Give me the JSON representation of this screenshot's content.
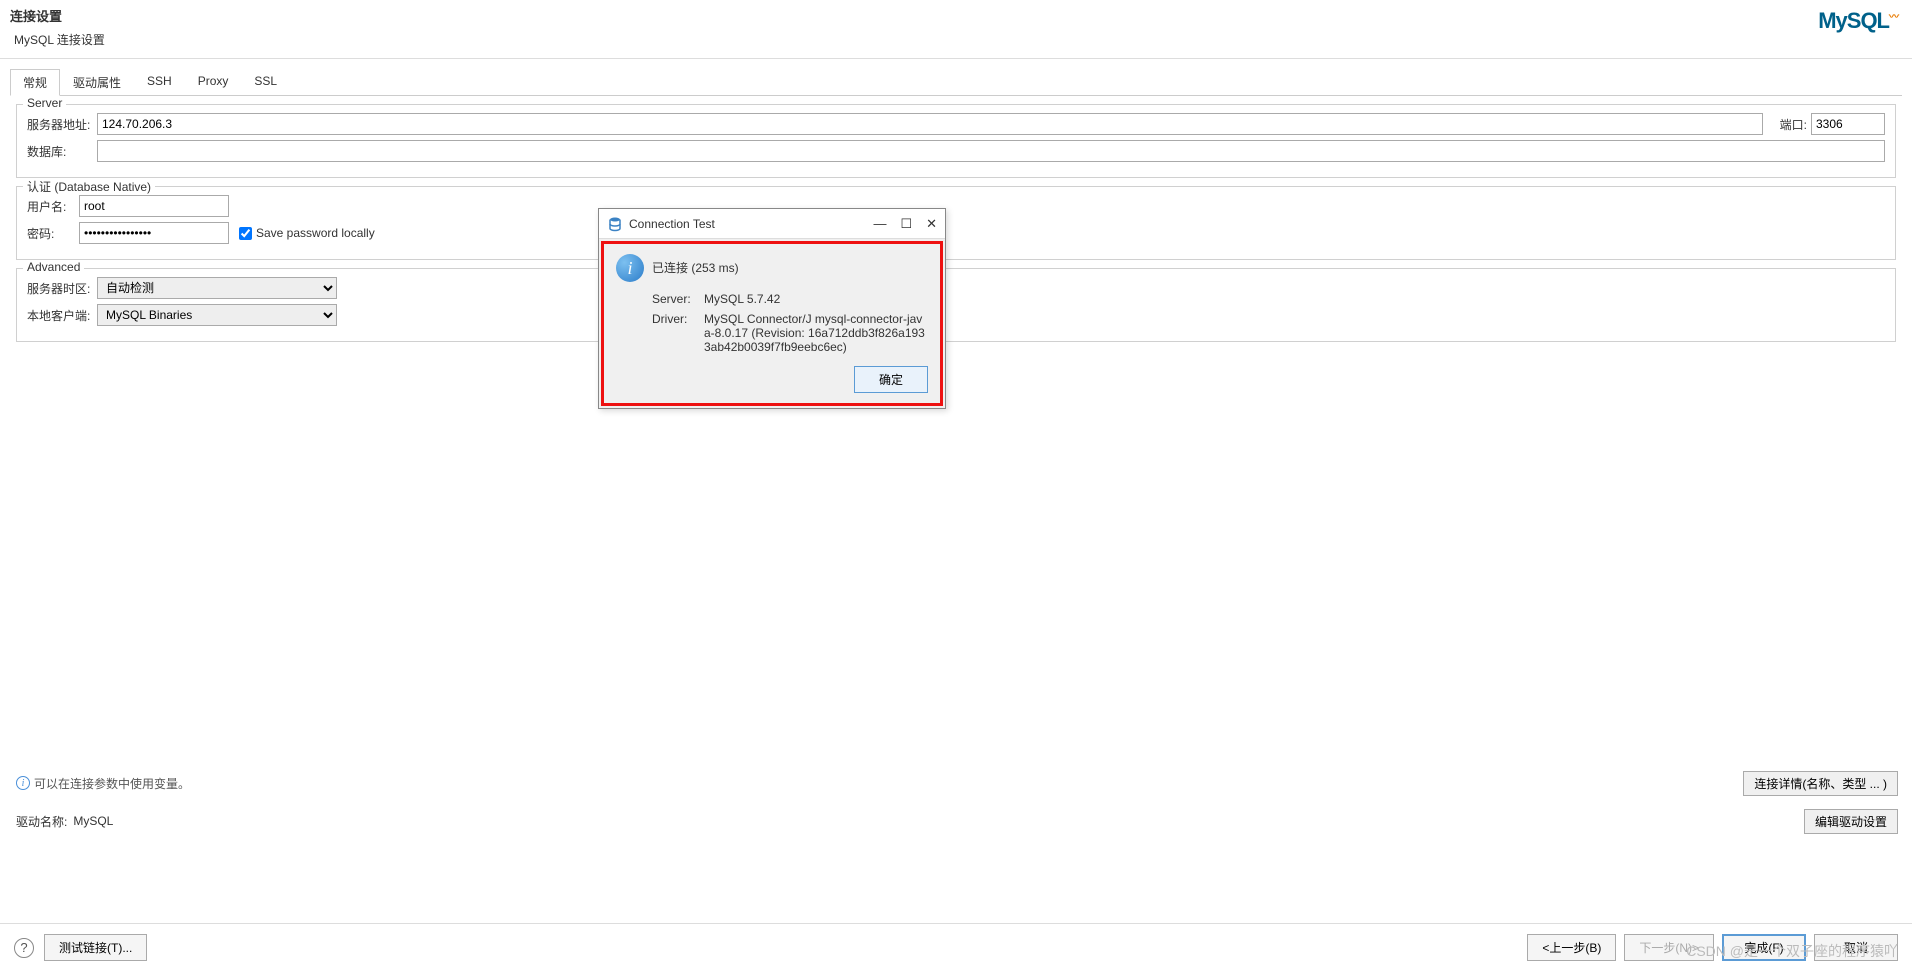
{
  "header": {
    "title": "连接设置",
    "subtitle": "MySQL 连接设置",
    "logo_text": "MySQL"
  },
  "tabs": {
    "items": [
      {
        "label": "常规"
      },
      {
        "label": "驱动属性"
      },
      {
        "label": "SSH"
      },
      {
        "label": "Proxy"
      },
      {
        "label": "SSL"
      }
    ]
  },
  "server_group": {
    "legend": "Server",
    "host_label": "服务器地址:",
    "host_value": "124.70.206.3",
    "port_label": "端口:",
    "port_value": "3306",
    "db_label": "数据库:",
    "db_value": ""
  },
  "auth_group": {
    "legend": "认证 (Database Native)",
    "user_label": "用户名:",
    "user_value": "root",
    "password_label": "密码:",
    "password_value": "••••••••••••••••",
    "save_password_label": "Save password locally",
    "save_password_checked": true
  },
  "advanced_group": {
    "legend": "Advanced",
    "timezone_label": "服务器时区:",
    "timezone_value": "自动检测",
    "client_label": "本地客户端:",
    "client_value": "MySQL Binaries"
  },
  "info": {
    "hint": "可以在连接参数中使用变量。",
    "conn_details_btn": "连接详情(名称、类型 ... )",
    "driver_name_label": "驱动名称:",
    "driver_name_value": "MySQL",
    "edit_driver_btn": "编辑驱动设置"
  },
  "footer": {
    "test_btn": "测试链接(T)...",
    "back_btn": "<上一步(B)",
    "next_btn": "下一步(N)>",
    "finish_btn": "完成(F)",
    "cancel_btn": "取消"
  },
  "dialog": {
    "title": "Connection Test",
    "connected_text": "已连接 (253 ms)",
    "server_label": "Server:",
    "server_value": "MySQL 5.7.42",
    "driver_label": "Driver:",
    "driver_value": "MySQL Connector/J mysql-connector-java-8.0.17 (Revision: 16a712ddb3f826a1933ab42b0039f7fb9eebc6ec)",
    "ok_btn": "确定"
  },
  "watermark": "CSDN @是一个双子座的程序猿吖"
}
